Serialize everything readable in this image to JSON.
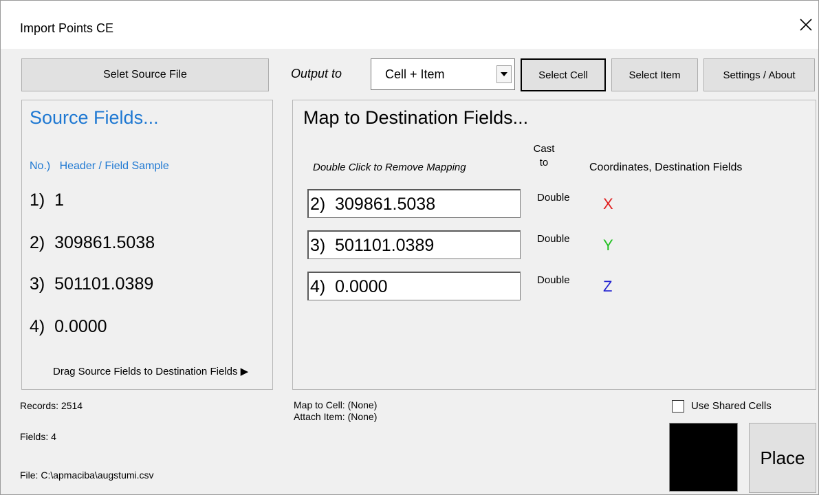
{
  "window": {
    "title": "Import Points CE",
    "close_icon": "close-icon"
  },
  "toolbar": {
    "source_button": "Selet Source File",
    "output_label": "Output to",
    "output_value": "Cell + Item",
    "select_cell": "Select Cell",
    "select_item": "Select Item",
    "settings": "Settings / About"
  },
  "source": {
    "heading": "Source Fields...",
    "col_header": "No.)   Header / Field Sample",
    "fields": [
      "1)  1",
      "2)  309861.5038",
      "3)  501101.0389",
      "4)  0.0000"
    ],
    "drag_hint": "Drag Source Fields to Destination Fields ▶"
  },
  "mapping": {
    "heading": "Map to Destination Fields...",
    "hint": "Double Click to Remove Mapping",
    "cast_label": "Cast to",
    "coord_header": "Coordinates, Destination Fields",
    "rows": [
      {
        "field": "2)  309861.5038",
        "cast": "Double",
        "axis": "X",
        "color": "#e02020"
      },
      {
        "field": "3)  501101.0389",
        "cast": "Double",
        "axis": "Y",
        "color": "#20c020"
      },
      {
        "field": "4)  0.0000",
        "cast": "Double",
        "axis": "Z",
        "color": "#2020d0"
      }
    ]
  },
  "status": {
    "records": "Records: 2514",
    "fields": "Fields: 4",
    "file": "File: C:\\apmaciba\\augstumi.csv",
    "map_to_cell": "Map to Cell:  (None)",
    "attach_item": "Attach Item: (None)"
  },
  "options": {
    "use_shared_cells": "Use Shared Cells",
    "use_shared_cells_checked": false,
    "swatch_color": "#000000",
    "place": "Place"
  }
}
